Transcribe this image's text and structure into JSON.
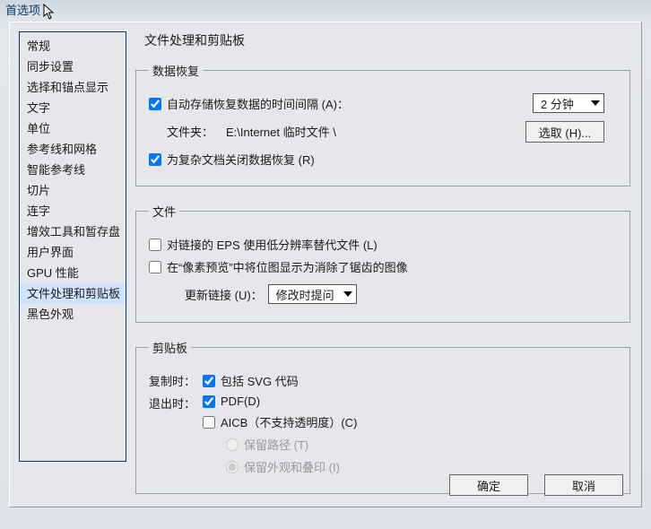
{
  "window": {
    "title": "首选项"
  },
  "sidebar": {
    "items": [
      {
        "label": "常规"
      },
      {
        "label": "同步设置"
      },
      {
        "label": "选择和锚点显示"
      },
      {
        "label": "文字"
      },
      {
        "label": "单位"
      },
      {
        "label": "参考线和网格"
      },
      {
        "label": "智能参考线"
      },
      {
        "label": "切片"
      },
      {
        "label": "连字"
      },
      {
        "label": "增效工具和暂存盘"
      },
      {
        "label": "用户界面"
      },
      {
        "label": "GPU 性能"
      },
      {
        "label": "文件处理和剪贴板"
      },
      {
        "label": "黑色外观"
      }
    ],
    "selected_index": 12
  },
  "heading": "文件处理和剪贴板",
  "recovery": {
    "legend": "数据恢复",
    "auto_save_label": "自动存储恢复数据的时间间隔 (A)：",
    "interval_display": "2 分钟",
    "folder_label": "文件夹：",
    "folder_path": "E:\\Internet 临时文件 \\",
    "choose_btn": "选取 (H)...",
    "disable_complex_label": "为复杂文档关闭数据恢复 (R)"
  },
  "files": {
    "legend": "文件",
    "low_res_eps_label": "对链接的 EPS 使用低分辨率替代文件 (L)",
    "pixel_preview_label": "在“像素预览”中将位图显示为消除了锯齿的图像",
    "update_links_label": "更新链接 (U)：",
    "update_links_value": "修改时提问"
  },
  "clipboard": {
    "legend": "剪贴板",
    "on_copy_label": "复制时：",
    "include_svg_label": "包括 SVG 代码",
    "on_quit_label": "退出时：",
    "pdf_label": "PDF(D)",
    "aicb_label": "AICB（不支持透明度）(C)",
    "preserve_paths_label": "保留路径 (T)",
    "preserve_appearance_label": "保留外观和叠印 (I)"
  },
  "buttons": {
    "ok": "确定",
    "cancel": "取消"
  }
}
